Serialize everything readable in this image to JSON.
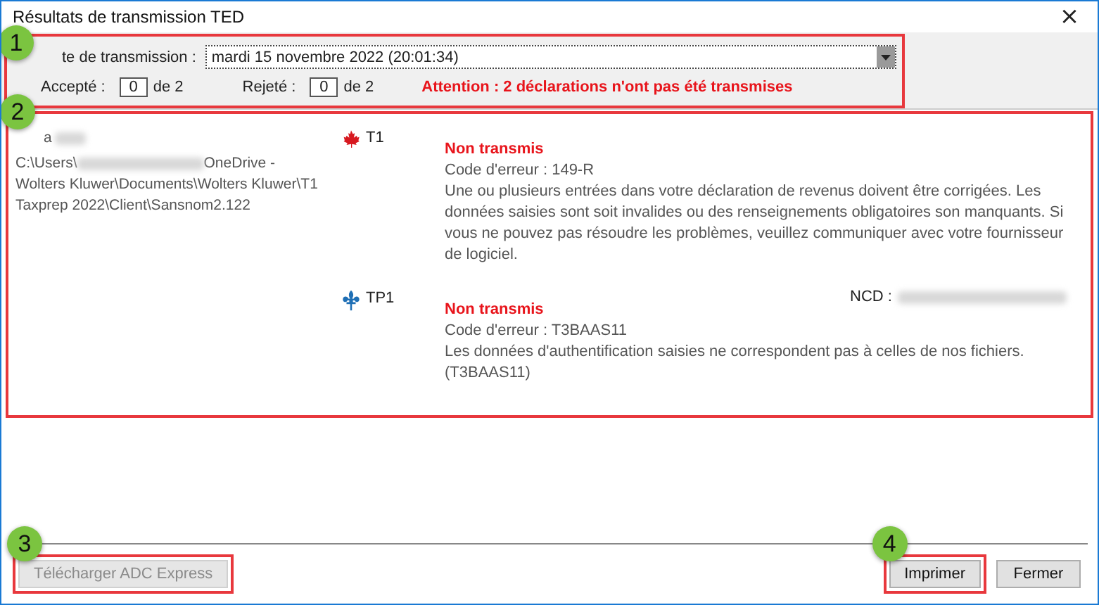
{
  "window": {
    "title": "Résultats de transmission TED",
    "close": "×"
  },
  "header": {
    "callout": "1",
    "date_label": "te de transmission :",
    "date_value": "mardi 15 novembre 2022 (20:01:34)",
    "accepted_label": "Accepté :",
    "accepted_value": "0",
    "accepted_total": "de 2",
    "rejected_label": "Rejeté :",
    "rejected_value": "0",
    "rejected_total": "de 2",
    "warning": "Attention : 2 déclarations n'ont pas été transmises"
  },
  "results": {
    "callout": "2",
    "client_name": "a",
    "path_start": "C:\\Users\\",
    "path_rest": "OneDrive - Wolters Kluwer\\Documents\\Wolters Kluwer\\T1 Taxprep 2022\\Client\\Sansnom2.122",
    "returns": [
      {
        "kind": "federal",
        "form": "T1",
        "status": "Non transmis",
        "error_code": "Code d'erreur : 149-R",
        "message": "Une ou plusieurs entrées dans votre déclaration de revenus doivent être corrigées. Les données saisies sont soit invalides ou des renseignements obligatoires son manquants. Si vous ne pouvez pas résoudre les problèmes, veuillez communiquer avec votre fournisseur de logiciel."
      },
      {
        "kind": "quebec",
        "form": "TP1",
        "status": "Non transmis",
        "ncd_label": "NCD :",
        "error_code": "Code d'erreur : T3BAAS11",
        "message": "Les données d'authentification saisies ne correspondent pas à celles de nos fichiers. (T3BAAS11)"
      }
    ]
  },
  "footer": {
    "download": {
      "callout": "3",
      "label": "Télécharger ADC Express",
      "disabled": true
    },
    "print": {
      "callout": "4",
      "label": "Imprimer"
    },
    "close": {
      "label": "Fermer"
    }
  }
}
